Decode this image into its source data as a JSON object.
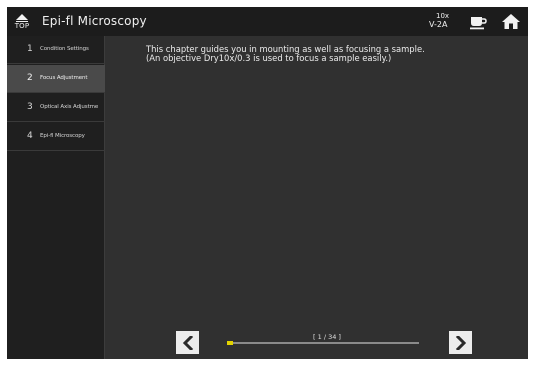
{
  "header": {
    "top_label": "TOP",
    "title": "Epi-fl Microscopy",
    "objective_magnification": "10x",
    "objective_prefix": "V",
    "objective_name": "2A",
    "icons": [
      "top-arrow-icon",
      "coffee-cup-icon",
      "home-icon"
    ]
  },
  "sidebar": {
    "items": [
      {
        "number": "1",
        "label": "Condition Settings"
      },
      {
        "number": "2",
        "label": "Focus Adjustment"
      },
      {
        "number": "3",
        "label": "Optical Axis Adjustme"
      },
      {
        "number": "4",
        "label": "Epi-fl Microscopy"
      }
    ],
    "active_index": 1
  },
  "content": {
    "line1": "This chapter guides you in mounting as well as focusing a sample.",
    "line2": "(An objective Dry10x/0.3 is used to focus a sample easily.)"
  },
  "pager": {
    "indicator": "[ 1 / 34 ]",
    "current_page": 1,
    "total_pages": 34,
    "progress_fraction": 0.03
  },
  "colors": {
    "background": "#303030",
    "header": "#1c1c1c",
    "sidebar": "#1f1f1f",
    "sidebar_active": "#4a4a4a",
    "progress_fill": "#e3d300",
    "progress_track": "#8a8a8a"
  }
}
